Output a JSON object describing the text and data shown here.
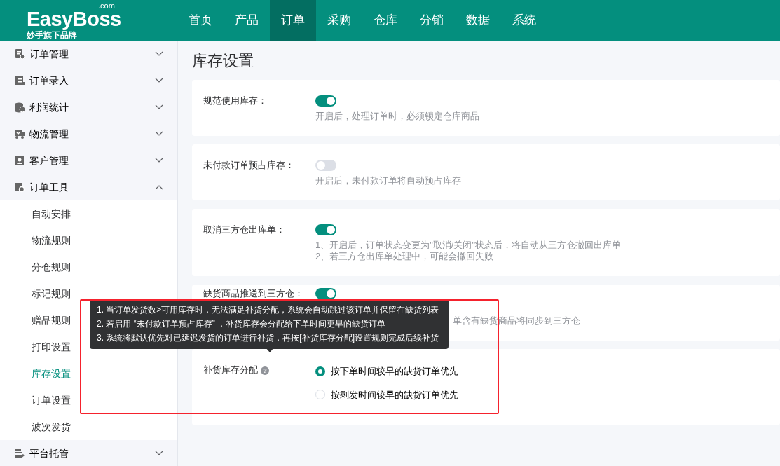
{
  "brand": {
    "logo": "EasyBoss",
    "domain": ".com",
    "tagline": "妙手旗下品牌"
  },
  "nav": [
    {
      "label": "首页",
      "selected": false
    },
    {
      "label": "产品",
      "selected": false
    },
    {
      "label": "订单",
      "selected": true
    },
    {
      "label": "采购",
      "selected": false
    },
    {
      "label": "仓库",
      "selected": false
    },
    {
      "label": "分销",
      "selected": false
    },
    {
      "label": "数据",
      "selected": false
    },
    {
      "label": "系统",
      "selected": false
    }
  ],
  "sidebar": {
    "items": [
      {
        "label": "订单管理",
        "expanded": false
      },
      {
        "label": "订单录入",
        "expanded": false
      },
      {
        "label": "利润统计",
        "expanded": false
      },
      {
        "label": "物流管理",
        "expanded": false
      },
      {
        "label": "客户管理",
        "expanded": false
      },
      {
        "label": "订单工具",
        "expanded": true,
        "children": [
          {
            "label": "自动安排",
            "selected": false
          },
          {
            "label": "物流规则",
            "selected": false
          },
          {
            "label": "分仓规则",
            "selected": false
          },
          {
            "label": "标记规则",
            "selected": false
          },
          {
            "label": "赠品规则",
            "selected": false
          },
          {
            "label": "打印设置",
            "selected": false
          },
          {
            "label": "库存设置",
            "selected": true
          },
          {
            "label": "订单设置",
            "selected": false
          },
          {
            "label": "波次发货",
            "selected": false
          }
        ]
      },
      {
        "label": "平台托管",
        "expanded": false
      }
    ]
  },
  "page_title": "库存设置",
  "settings": [
    {
      "kind": "switch",
      "label": "规范使用库存：",
      "on": true,
      "description": [
        "开启后，处理订单时，必须锁定仓库商品"
      ]
    },
    {
      "kind": "switch",
      "label": "未付款订单预占库存：",
      "on": false,
      "description": [
        "开启后，未付款订单将自动预占库存"
      ]
    },
    {
      "kind": "switch",
      "label": "取消三方仓出库单：",
      "on": true,
      "description": [
        "1、开启后，订单状态变更为\"取消/关闭\"状态后，将自动从三方仓撤回出库单",
        "2、若三方仓出库单处理中，可能会撤回失败"
      ]
    },
    {
      "kind": "switch",
      "label": "缺货商品推送到三方仓：",
      "on": true,
      "covered": true,
      "description": [
        "单含有缺货商品将同步到三方仓"
      ]
    },
    {
      "kind": "radio",
      "label": "补货库存分配",
      "help": "?",
      "options": [
        {
          "label": "按下单时间较早的缺货订单优先",
          "selected": true
        },
        {
          "label": "按剩发时间较早的缺货订单优先",
          "selected": false
        }
      ]
    }
  ],
  "tooltip": [
    "1. 当订单发货数>可用库存时，无法满足补货分配，系统会自动跳过该订单并保留在缺货列表",
    "2. 若启用 “未付款订单预占库存” ，补货库存会分配给下单时间更早的缺货订单",
    "3. 系统将默认优先对已延迟发货的订单进行补货，再按[补货库存分配]设置规则完成后续补货"
  ],
  "highlight_frame": true
}
